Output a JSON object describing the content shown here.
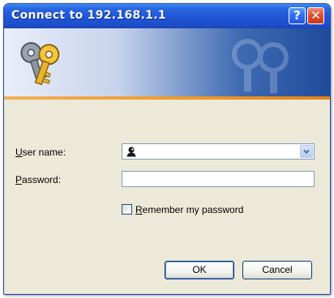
{
  "window": {
    "title": "Connect to 192.168.1.1",
    "help_glyph": "?",
    "close_glyph": "✕"
  },
  "form": {
    "username_label_prefix": "",
    "username_label_access": "U",
    "username_label_rest": "ser name:",
    "username_value": "",
    "username_icon": "user-icon",
    "password_label_access": "P",
    "password_label_rest": "assword:",
    "password_value": "",
    "remember_access": "R",
    "remember_rest": "emember my password",
    "remember_checked": false
  },
  "buttons": {
    "ok_label": "OK",
    "cancel_label": "Cancel"
  },
  "colors": {
    "titlebar": "#1f55d6",
    "dialog_bg": "#ece9d8",
    "accent_stripe": "#f09b2c",
    "close_button": "#df4d2b"
  }
}
